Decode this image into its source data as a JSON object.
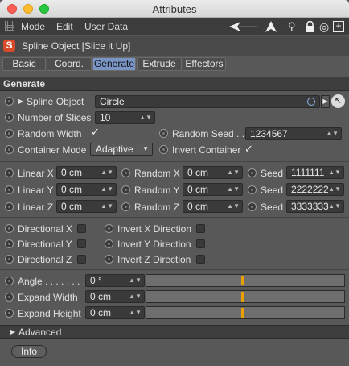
{
  "window": {
    "title": "Attributes"
  },
  "menu": {
    "items": [
      "Mode",
      "Edit",
      "User Data"
    ]
  },
  "object": {
    "name": "Spline Object [Slice it Up]"
  },
  "tabs": [
    "Basic",
    "Coord.",
    "Generate",
    "Extrude",
    "Effectors"
  ],
  "section": {
    "title": "Generate"
  },
  "params": {
    "spline_object": {
      "label": "Spline Object",
      "value": "Circle"
    },
    "number_of_slices": {
      "label": "Number of Slices",
      "value": "10"
    },
    "random_width": {
      "label": "Random Width",
      "check": "✓"
    },
    "random_seed": {
      "label": "Random Seed . .",
      "value": "1234567"
    },
    "container_mode": {
      "label": "Container Mode",
      "value": "Adaptive"
    },
    "invert_container": {
      "label": "Invert Container",
      "check": "✓"
    }
  },
  "grid": {
    "linear": [
      {
        "label": "Linear X",
        "value": "0 cm"
      },
      {
        "label": "Linear Y",
        "value": "0 cm"
      },
      {
        "label": "Linear Z",
        "value": "0 cm"
      }
    ],
    "random": [
      {
        "label": "Random X",
        "value": "0 cm"
      },
      {
        "label": "Random Y",
        "value": "0 cm"
      },
      {
        "label": "Random Z",
        "value": "0 cm"
      }
    ],
    "seed": [
      {
        "label": "Seed",
        "value": "1111111"
      },
      {
        "label": "Seed",
        "value": "2222222"
      },
      {
        "label": "Seed",
        "value": "3333333"
      }
    ]
  },
  "directional": [
    "Directional X",
    "Directional Y",
    "Directional Z"
  ],
  "invert": [
    "Invert X Direction",
    "Invert Y Direction",
    "Invert Z Direction"
  ],
  "sliders": [
    {
      "label": "Angle . . . . . . . .",
      "value": "0 °",
      "level": 0.48
    },
    {
      "label": "Expand Width",
      "value": "0 cm",
      "level": 0.48
    },
    {
      "label": "Expand Height",
      "value": "0 cm",
      "level": 0.48
    }
  ],
  "advanced": {
    "label": "Advanced"
  },
  "info": {
    "label": "Info"
  },
  "colors": {
    "accent": "#7895c6",
    "slider_marker": "#e8a000",
    "logo": "#d84a2a"
  }
}
